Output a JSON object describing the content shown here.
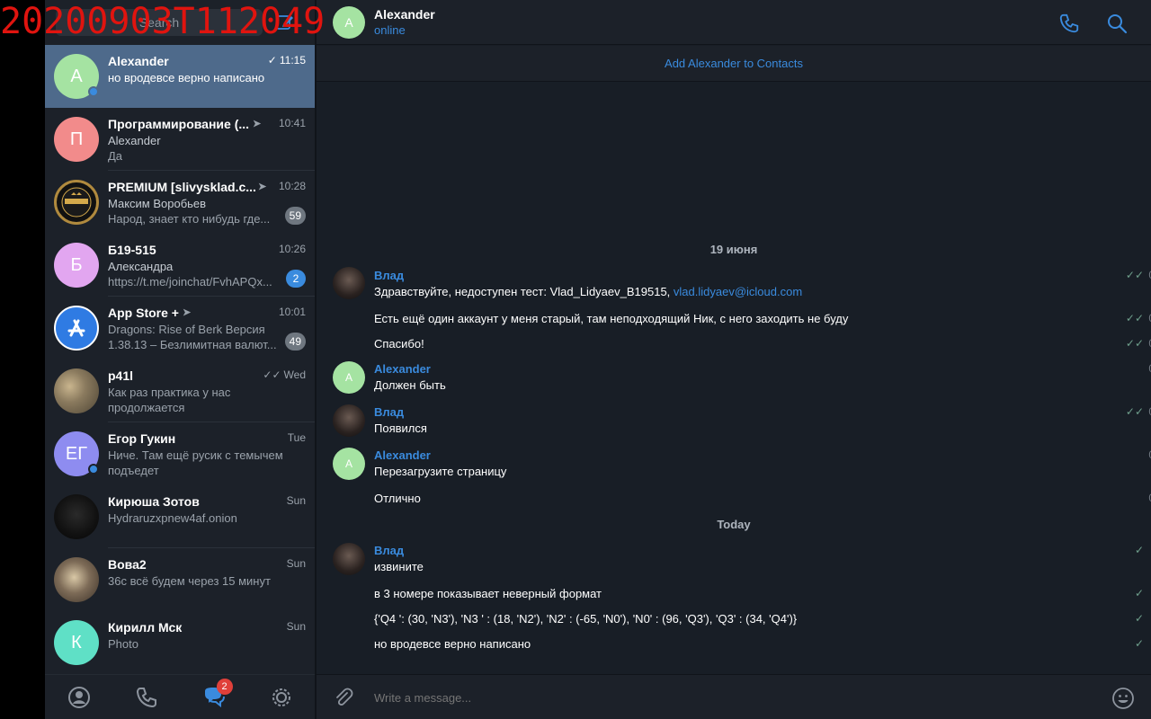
{
  "watermark": "20200903T112049",
  "sidebar": {
    "search_placeholder": "Search",
    "chats": [
      {
        "avatar_letter": "A",
        "avatar_color": "#a5e3a2",
        "title": "Alexander",
        "time": "11:15",
        "line1": "но вродевсе верно написано",
        "line2": "",
        "read_check": true,
        "online": true,
        "active": true,
        "badge": ""
      },
      {
        "avatar_letter": "П",
        "avatar_color": "#f28b8b",
        "title": "Программирование (...",
        "time": "10:41",
        "line1": "Alexander",
        "line2": "Да",
        "channel": true,
        "badge": ""
      },
      {
        "avatar_letter": "",
        "avatar_color": "#111111",
        "title": "PREMIUM [slivysklad.c...",
        "time": "10:28",
        "line1": "Максим Воробьев",
        "line2": "Народ, знает кто нибудь где...",
        "channel": true,
        "badge": "59",
        "badge_muted": true
      },
      {
        "avatar_letter": "Б",
        "avatar_color": "#e2a6f0",
        "title": "Б19-515",
        "time": "10:26",
        "line1": "Александра",
        "line2": "https://t.me/joinchat/FvhAPQx...",
        "badge": "2",
        "badge_muted": false
      },
      {
        "avatar_letter": "",
        "avatar_color": "#2f7be3",
        "title": "App Store +",
        "time": "10:01",
        "line1": "Dragons: Rise of Berk Версия",
        "line2": "1.38.13 – Безлимитная валют...",
        "channel": true,
        "badge": "49",
        "badge_muted": true
      },
      {
        "avatar_letter": "",
        "avatar_color": "#8a7a5e",
        "title": "p41l",
        "time": "Wed",
        "line1": "Как раз практика у нас",
        "line2": "продолжается",
        "double_check": true,
        "badge": ""
      },
      {
        "avatar_letter": "ЕГ",
        "avatar_color": "#8e8cf0",
        "title": "Егор Гукин",
        "time": "Tue",
        "line1": "Ниче. Там ещё русик с темычем",
        "line2": "подъедет",
        "online": true,
        "badge": ""
      },
      {
        "avatar_letter": "",
        "avatar_color": "#151515",
        "title": "Кирюша Зотов",
        "time": "Sun",
        "line1": "Hydraruzxpnew4af.onion",
        "line2": "",
        "badge": ""
      },
      {
        "avatar_letter": "",
        "avatar_color": "#7d6b57",
        "title": "Вова2",
        "time": "Sun",
        "line1": "36с всё будем через 15 минут",
        "line2": "",
        "badge": ""
      },
      {
        "avatar_letter": "К",
        "avatar_color": "#5fe0c6",
        "title": "Кирилл Мск",
        "time": "Sun",
        "line1": "Photo",
        "line2": "",
        "badge": ""
      }
    ],
    "tabs_badge": "2"
  },
  "header": {
    "avatar_letter": "A",
    "name": "Alexander",
    "status": "online"
  },
  "add_contact": "Add Alexander to Contacts",
  "messages": {
    "date1": "19 июня",
    "date2": "Today",
    "vlad_name": "Влад",
    "alex_name": "Alexander",
    "alex_avatar_letter": "A",
    "m1_text": "Здравствуйте, недоступен тест: Vlad_Lidyaev_B19515, ",
    "m1_link": "vlad.lidyaev@icloud.com",
    "m2_text": "Есть ещё один аккаунт у меня старый, там неподходящий Ник, с него заходить не буду",
    "m3_text": "Спасибо!",
    "m4_text": "Должен быть",
    "m5_text": "Появился",
    "m6_text": "Перезагрузите страницу",
    "m7_text": "Отлично",
    "m8_text": "извините",
    "m9_text": "в 3 номере показывает неверный формат",
    "m10_text": "{'Q4 ': (30, 'N3'), 'N3 ' : (18, 'N2'), 'N2' : (-65, 'N0'), 'N0' : (96, 'Q3'), 'Q3' : (34, 'Q4')}",
    "m11_text": "но вродевсе верно написано",
    "partial_time_char": "0"
  },
  "composer": {
    "placeholder": "Write a message..."
  }
}
